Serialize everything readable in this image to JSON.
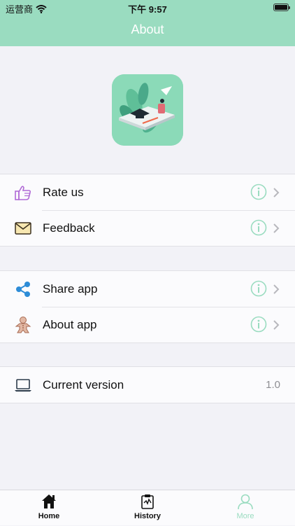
{
  "status_bar": {
    "carrier": "运营商",
    "time": "下午 9:57"
  },
  "header": {
    "title": "About"
  },
  "menu_groups": [
    {
      "items": [
        {
          "label": "Rate us",
          "icon": "thumbs-up-icon"
        },
        {
          "label": "Feedback",
          "icon": "envelope-icon"
        }
      ]
    },
    {
      "items": [
        {
          "label": "Share app",
          "icon": "share-icon"
        },
        {
          "label": "About app",
          "icon": "gingerbread-icon"
        }
      ]
    }
  ],
  "version": {
    "label": "Current version",
    "value": "1.0",
    "icon": "laptop-icon"
  },
  "tabbar": {
    "tabs": [
      {
        "label": "Home",
        "icon": "home-icon"
      },
      {
        "label": "History",
        "icon": "clipboard-icon"
      },
      {
        "label": "More",
        "icon": "person-icon",
        "active": true
      }
    ]
  },
  "colors": {
    "accent": "#9adcc0",
    "background": "#f2f2f7"
  }
}
